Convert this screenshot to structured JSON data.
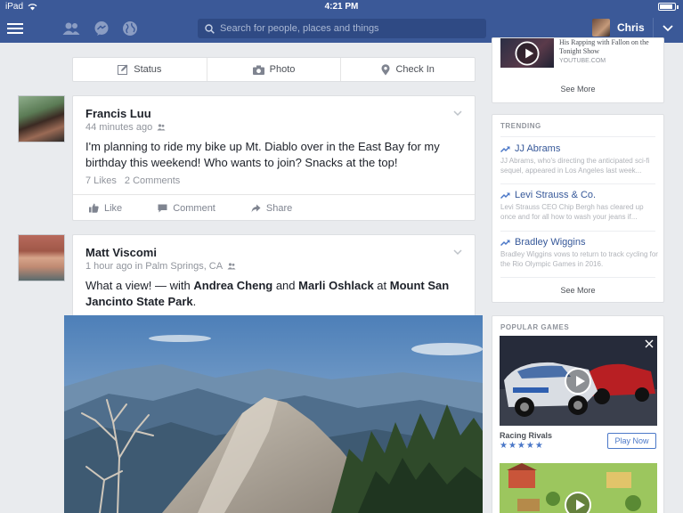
{
  "status_bar": {
    "carrier": "iPad",
    "time": "4:21 PM"
  },
  "nav": {
    "search_placeholder": "Search for people, places and things",
    "user_name": "Chris"
  },
  "composer": {
    "status": "Status",
    "photo": "Photo",
    "checkin": "Check In"
  },
  "posts": [
    {
      "author": "Francis Luu",
      "time": "44 minutes ago",
      "text": "I'm planning to ride my bike up Mt. Diablo over in the East Bay for my birthday this weekend! Who wants to join? Snacks at the top!",
      "likes": "7 Likes",
      "comments": "2 Comments",
      "actions": {
        "like": "Like",
        "comment": "Comment",
        "share": "Share"
      }
    },
    {
      "author": "Matt Viscomi",
      "time": "1 hour ago in Palm Springs, CA",
      "text_prefix": "What a view! — with ",
      "tag1": "Andrea Cheng",
      "text_and": " and ",
      "tag2": "Marli Oshlack",
      "text_at": " at ",
      "place": "Mount San Jancinto State Park",
      "text_end": "."
    }
  ],
  "sidebar": {
    "video": {
      "title": "His Rapping with Fallon on the Tonight Show",
      "source": "YOUTUBE.COM",
      "see_more": "See More"
    },
    "trending": {
      "title": "TRENDING",
      "items": [
        {
          "name": "JJ Abrams",
          "desc": "JJ Abrams, who's directing the anticipated sci-fi sequel, appeared in Los Angeles last week..."
        },
        {
          "name": "Levi Strauss & Co.",
          "desc": "Levi Strauss CEO Chip Bergh has cleared up once and for all how to wash your jeans if..."
        },
        {
          "name": "Bradley Wiggins",
          "desc": "Bradley Wiggins vows to return to track cycling for the Rio Olympic Games in 2016."
        }
      ],
      "see_more": "See More"
    },
    "games": {
      "title": "POPULAR GAMES",
      "game_name": "Racing Rivals",
      "rating": "★★★★★",
      "play_label": "Play Now"
    }
  },
  "colors": {
    "brand": "#3b5998",
    "link": "#365899"
  }
}
